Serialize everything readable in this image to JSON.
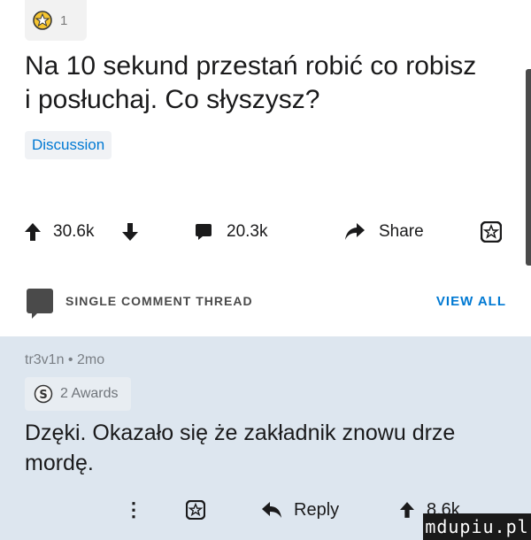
{
  "post": {
    "award_count": "1",
    "title": "Na 10 sekund przestań robić co robisz i posłuchaj. Co słyszysz?",
    "flair": "Discussion",
    "upvotes": "30.6k",
    "comments": "20.3k",
    "share_label": "Share"
  },
  "thread_bar": {
    "label": "SINGLE COMMENT THREAD",
    "view_all": "VIEW ALL"
  },
  "comment": {
    "meta": "tr3v1n • 2mo",
    "awards": "2 Awards",
    "body": "Dzęki. Okazało się że zakładnik znowu drze mordę.",
    "reply_label": "Reply",
    "score": "8.6k"
  },
  "watermark": "mdupiu.pl",
  "colors": {
    "accent_blue": "#0079d3",
    "comment_bg": "#dde6ef",
    "text": "#1a1a1b"
  }
}
